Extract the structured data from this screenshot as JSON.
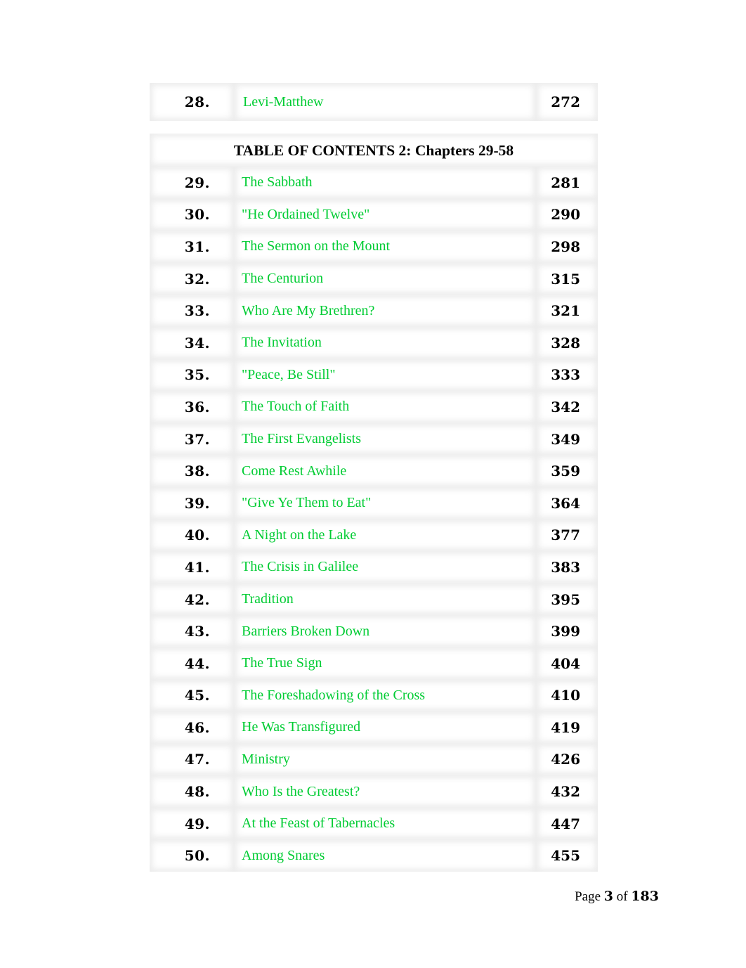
{
  "document": {
    "prev_section_entries": [
      {
        "number": "28.",
        "title": "Levi-Matthew",
        "page": "272"
      }
    ],
    "heading": "TABLE OF CONTENTS 2: Chapters 29-58",
    "entries": [
      {
        "number": "29.",
        "title": "The Sabbath",
        "page": "281"
      },
      {
        "number": "30.",
        "title": "\"He Ordained Twelve\"",
        "page": "290"
      },
      {
        "number": "31.",
        "title": "The Sermon on the Mount",
        "page": "298"
      },
      {
        "number": "32.",
        "title": "The Centurion",
        "page": "315"
      },
      {
        "number": "33.",
        "title": "Who Are My Brethren?",
        "page": "321"
      },
      {
        "number": "34.",
        "title": "The Invitation",
        "page": "328"
      },
      {
        "number": "35.",
        "title": "\"Peace, Be Still\"",
        "page": "333"
      },
      {
        "number": "36.",
        "title": "The Touch of Faith",
        "page": "342"
      },
      {
        "number": "37.",
        "title": "The First Evangelists",
        "page": "349"
      },
      {
        "number": "38.",
        "title": "Come Rest Awhile",
        "page": "359"
      },
      {
        "number": "39.",
        "title": "\"Give Ye Them to Eat\"",
        "page": "364"
      },
      {
        "number": "40.",
        "title": "A Night on the Lake",
        "page": "377"
      },
      {
        "number": "41.",
        "title": "The Crisis in Galilee",
        "page": "383"
      },
      {
        "number": "42.",
        "title": "Tradition",
        "page": "395"
      },
      {
        "number": "43.",
        "title": "Barriers Broken Down",
        "page": "399"
      },
      {
        "number": "44.",
        "title": "The True Sign",
        "page": "404"
      },
      {
        "number": "45.",
        "title": "The Foreshadowing of the Cross",
        "page": "410"
      },
      {
        "number": "46.",
        "title": "He Was Transfigured",
        "page": "419"
      },
      {
        "number": "47.",
        "title": "Ministry",
        "page": "426"
      },
      {
        "number": "48.",
        "title": "Who Is the Greatest?",
        "page": "432"
      },
      {
        "number": "49.",
        "title": "At the Feast of Tabernacles",
        "page": "447"
      },
      {
        "number": "50.",
        "title": "Among Snares",
        "page": "455"
      }
    ],
    "link_color": "#00cc33"
  },
  "footer": {
    "page_prefix": "Page",
    "current_page": "3",
    "of_label": "of",
    "total_pages": "183"
  }
}
